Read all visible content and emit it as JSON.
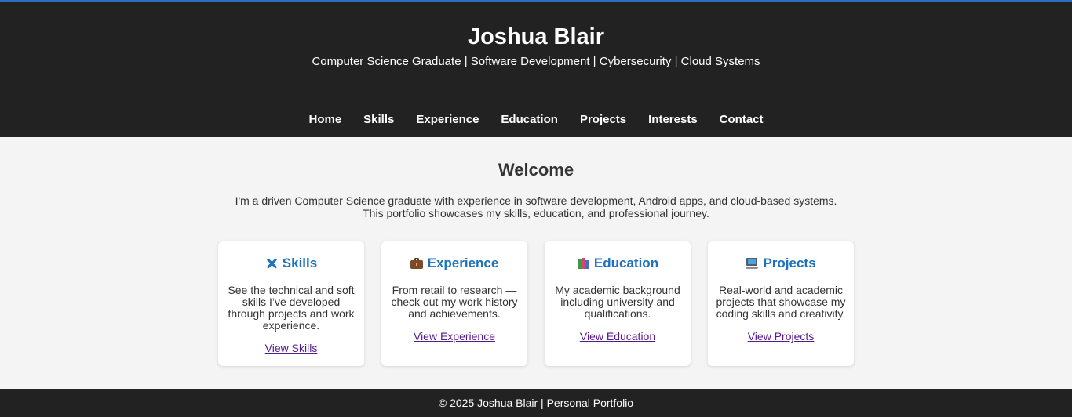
{
  "header": {
    "title": "Joshua Blair",
    "tagline": "Computer Science Graduate | Software Development | Cybersecurity | Cloud Systems"
  },
  "nav": [
    {
      "label": "Home"
    },
    {
      "label": "Skills"
    },
    {
      "label": "Experience"
    },
    {
      "label": "Education"
    },
    {
      "label": "Projects"
    },
    {
      "label": "Interests"
    },
    {
      "label": "Contact"
    }
  ],
  "welcome": {
    "title": "Welcome",
    "intro_line1": "I'm a driven Computer Science graduate with experience in software development, Android apps, and cloud-based systems.",
    "intro_line2": "This portfolio showcases my skills, education, and professional journey."
  },
  "cards": [
    {
      "icon": "tools-icon",
      "title": "Skills",
      "description": "See the technical and soft skills I’ve developed through projects and work experience.",
      "link": "View Skills"
    },
    {
      "icon": "briefcase-icon",
      "title": "Experience",
      "description": "From retail to research — check out my work history and achievements.",
      "link": "View Experience"
    },
    {
      "icon": "books-icon",
      "title": "Education",
      "description": "My academic background including university and qualifications.",
      "link": "View Education"
    },
    {
      "icon": "laptop-icon",
      "title": "Projects",
      "description": "Real-world and academic projects that showcase my coding skills and creativity.",
      "link": "View Projects"
    }
  ],
  "footer": {
    "text": "© 2025 Joshua Blair | Personal Portfolio"
  },
  "colors": {
    "header_bg": "#222222",
    "accent": "#1e73be",
    "link": "#551a8b",
    "page_bg": "#f4f4f4"
  }
}
